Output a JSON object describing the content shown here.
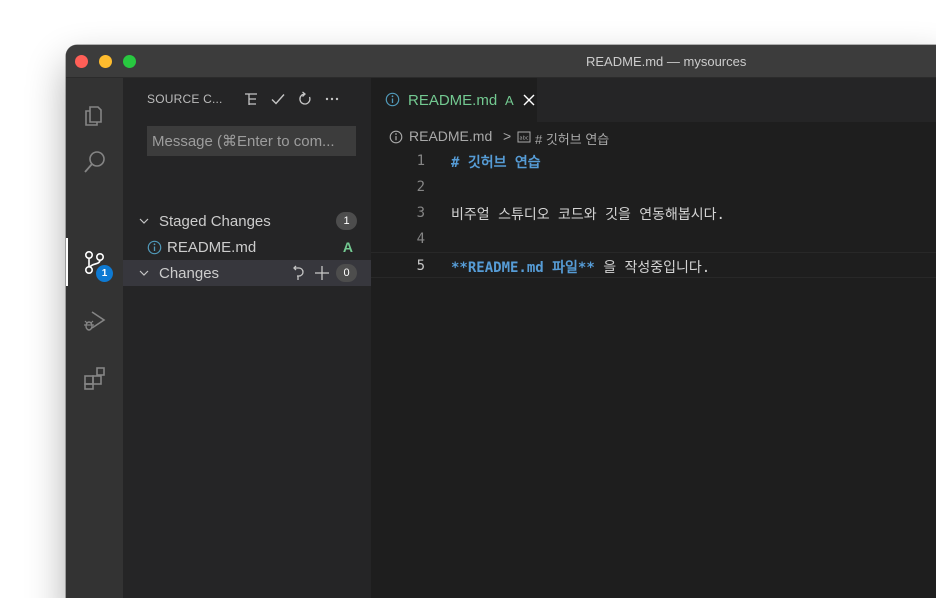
{
  "window": {
    "title": "README.md — mysources"
  },
  "activity_bar": {
    "items": [
      {
        "name": "explorer",
        "icon": "files-icon"
      },
      {
        "name": "search",
        "icon": "search-icon"
      },
      {
        "name": "source-control",
        "icon": "source-control-icon",
        "badge": "1"
      },
      {
        "name": "run-debug",
        "icon": "run-debug-icon"
      },
      {
        "name": "extensions",
        "icon": "extensions-icon"
      }
    ]
  },
  "sidebar": {
    "title": "SOURCE C...",
    "actions": [
      "view-as-tree-icon",
      "commit-check-icon",
      "refresh-icon",
      "more-actions-icon"
    ],
    "message_placeholder": "Message (⌘Enter to com...",
    "staged": {
      "label": "Staged Changes",
      "count": "1",
      "files": [
        {
          "name": "README.md",
          "status": "A"
        }
      ]
    },
    "changes": {
      "label": "Changes",
      "count": "0"
    }
  },
  "editor": {
    "tab": {
      "label": "README.md",
      "status": "A"
    },
    "breadcrumb": {
      "file": "README.md",
      "separator": ">",
      "symbol": "# 깃허브 연습"
    },
    "lines": [
      {
        "number": "1",
        "text": "# 깃허브 연습"
      },
      {
        "number": "2",
        "text": ""
      },
      {
        "number": "3",
        "text": "비주얼 스튜디오 코드와 깃을 연동해봅시다."
      },
      {
        "number": "4",
        "text": ""
      },
      {
        "number": "5",
        "bold": "**README.md 파일**",
        "rest": " 을 작성중입니다."
      }
    ],
    "active_line": "5"
  },
  "colors": {
    "added_green": "#73c991",
    "markdown_blue": "#569cd6",
    "badge_blue": "#0e7ad3"
  }
}
